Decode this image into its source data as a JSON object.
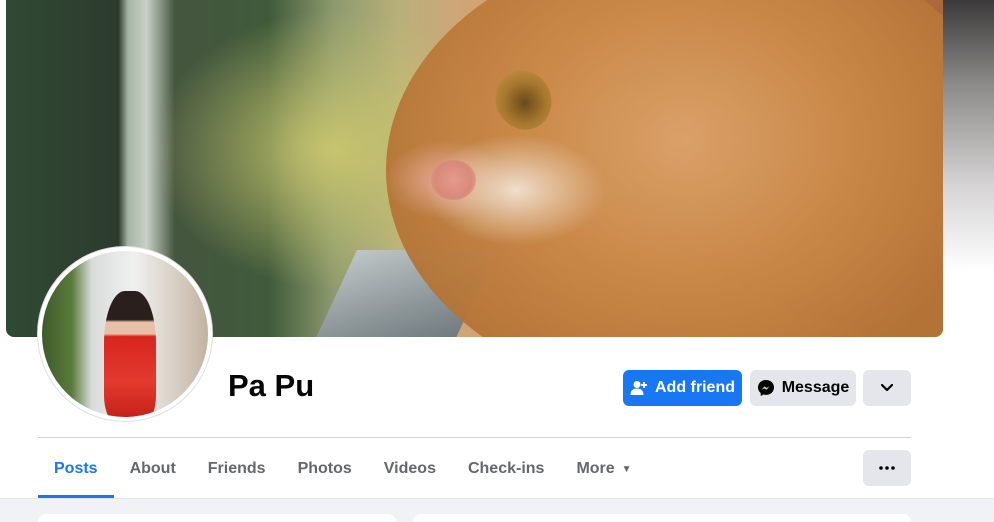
{
  "profile": {
    "name": "Pa Pu"
  },
  "actions": {
    "add_friend": "Add friend",
    "message": "Message"
  },
  "tabs": [
    {
      "label": "Posts",
      "active": true
    },
    {
      "label": "About",
      "active": false
    },
    {
      "label": "Friends",
      "active": false
    },
    {
      "label": "Photos",
      "active": false
    },
    {
      "label": "Videos",
      "active": false
    },
    {
      "label": "Check-ins",
      "active": false
    },
    {
      "label": "More",
      "active": false
    }
  ],
  "icons": {
    "add_friend": "person-add-icon",
    "message": "messenger-icon",
    "dropdown": "chevron-down-icon",
    "more_tab": "caret-down-icon",
    "options": "ellipsis-icon"
  },
  "colors": {
    "accent": "#1877f2",
    "button_gray": "#e4e6eb",
    "text_primary": "#050505",
    "text_secondary": "#65676b"
  }
}
